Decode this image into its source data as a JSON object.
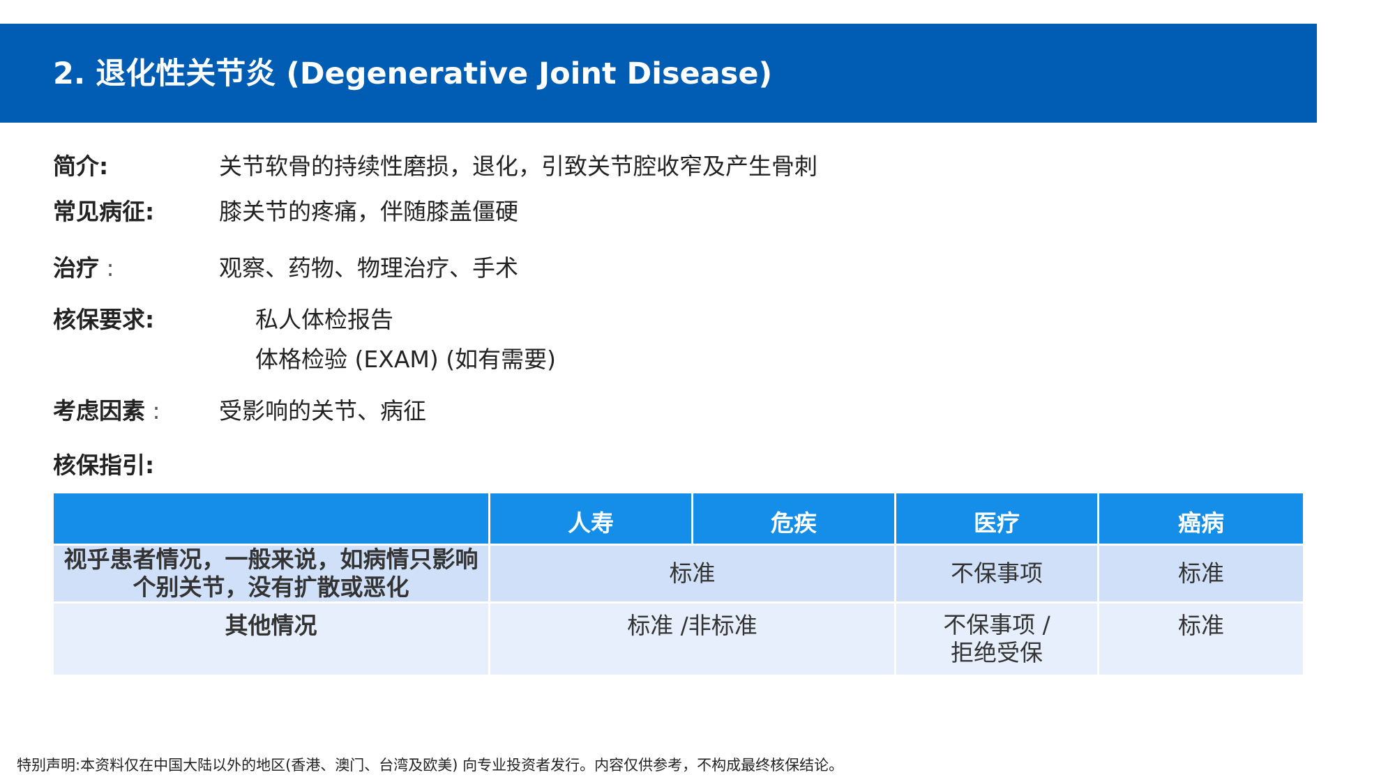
{
  "header": {
    "title": "2. 退化性关节炎 (Degenerative  Joint  Disease)"
  },
  "fields": {
    "intro": {
      "label": "简介:",
      "value": "关节软骨的持续性磨损，退化，引致关节腔收窄及产生骨刺"
    },
    "symptoms": {
      "label": "常见病征:",
      "value": "膝关节的疼痛，伴随膝盖僵硬"
    },
    "treatment": {
      "label": "治疗",
      "colon": " :",
      "value": "观察、药物、物理治疗、手术"
    },
    "requirements": {
      "label": "核保要求:",
      "values": [
        "私人体检报告",
        "体格检验 (EXAM) (如有需要)"
      ]
    },
    "factors": {
      "label": "考虑因素",
      "colon": " :",
      "value": "受影响的关节、病征"
    },
    "guide_label": "核保指引:"
  },
  "table": {
    "headers": [
      "",
      "人寿",
      "危疾",
      "医疗",
      "癌病"
    ],
    "rows": [
      {
        "condition": "视乎患者情况，一般来说，如病情只影响个别关节，没有扩散或恶化",
        "life_ci": "标准",
        "medical": "不保事项",
        "cancer": "标准"
      },
      {
        "condition": "其他情况",
        "life_ci": "标准 /非标准",
        "medical": "不保事项 / 拒绝受保",
        "cancer": "标准"
      }
    ]
  },
  "footer": {
    "disclaimer": "特别声明:本资料仅在中国大陆以外的地区(香港、澳门、台湾及欧美) 向专业投资者发行。内容仅供参考，不构成最终核保结论。"
  },
  "colors": {
    "header_bg": "#005db3",
    "table_header_bg": "#148ee8",
    "row1_bg": "#cfe0f8",
    "row2_bg": "#e6effb"
  }
}
